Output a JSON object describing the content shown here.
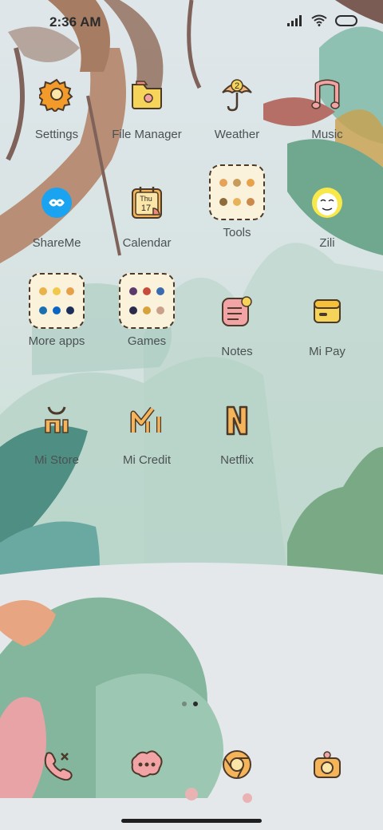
{
  "status": {
    "time": "2:36 AM"
  },
  "apps": [
    {
      "label": "Settings",
      "icon": "gear-icon"
    },
    {
      "label": "File Manager",
      "icon": "folder-icon"
    },
    {
      "label": "Weather",
      "icon": "umbrella-icon",
      "badge": "2"
    },
    {
      "label": "Music",
      "icon": "music-note-icon"
    },
    {
      "label": "ShareMe",
      "icon": "infinity-icon"
    },
    {
      "label": "Calendar",
      "icon": "calendar-icon",
      "day": "Thu",
      "date": "17"
    },
    {
      "label": "Tools",
      "icon": "folder-grid-icon"
    },
    {
      "label": "Zili",
      "icon": "smiley-face-icon"
    },
    {
      "label": "More apps",
      "icon": "folder-grid-icon"
    },
    {
      "label": "Games",
      "icon": "folder-grid-icon"
    },
    {
      "label": "Notes",
      "icon": "notepad-icon"
    },
    {
      "label": "Mi Pay",
      "icon": "wallet-icon"
    },
    {
      "label": "Mi Store",
      "icon": "shopping-bag-icon"
    },
    {
      "label": "Mi Credit",
      "icon": "mi-credit-icon"
    },
    {
      "label": "Netflix",
      "icon": "netflix-icon"
    }
  ],
  "dock": [
    {
      "name": "phone",
      "icon": "phone-icon"
    },
    {
      "name": "messages",
      "icon": "chat-bubble-icon"
    },
    {
      "name": "browser",
      "icon": "chrome-icon"
    },
    {
      "name": "camera",
      "icon": "camera-icon"
    }
  ],
  "pages": {
    "count": 2,
    "active": 2
  },
  "colors": {
    "accent_yellow": "#f6d45a",
    "icon_outline": "#4b3a2a",
    "label_color": "#4b5153",
    "shareme_blue": "#1aa3f0"
  }
}
